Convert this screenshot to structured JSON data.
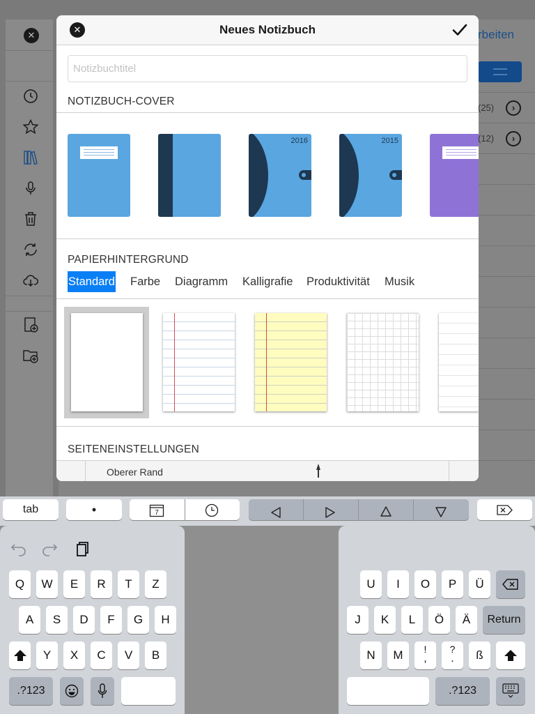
{
  "background": {
    "edit_label": "rbeiten",
    "rows": [
      {
        "count": "(25)"
      },
      {
        "count": "(12)"
      }
    ]
  },
  "modal": {
    "title": "Neues Notizbuch",
    "title_input": {
      "value": "",
      "placeholder": "Notizbuchtitel"
    },
    "cover_section_title": "NOTIZBUCH-COVER",
    "covers": [
      {
        "style": "labeled",
        "color": "#5aa6e0",
        "year": ""
      },
      {
        "style": "spine",
        "color": "#5aa6e0",
        "year": ""
      },
      {
        "style": "planner",
        "color": "#5aa6e0",
        "year": "2016"
      },
      {
        "style": "planner",
        "color": "#5aa6e0",
        "year": "2015"
      },
      {
        "style": "labeled",
        "color": "#8f72d6",
        "year": ""
      }
    ],
    "paper_section_title": "PAPIERHINTERGRUND",
    "paper_tabs": [
      "Standard",
      "Farbe",
      "Diagramm",
      "Kalligrafie",
      "Produktivität",
      "Musik"
    ],
    "active_paper_tab": "Standard",
    "papers": [
      "blank",
      "ruled",
      "yellow-ruled",
      "grid",
      "faint-ruled"
    ],
    "selected_paper": "blank",
    "page_settings_title": "SEITENEINSTELLUNGEN",
    "top_margin_label": "Oberer Rand"
  },
  "keyboard": {
    "toolbar": {
      "tab_label": "tab",
      "bullet_label": "•",
      "calendar_day": "7"
    },
    "left_rows": [
      [
        "Q",
        "W",
        "E",
        "R",
        "T",
        "Z"
      ],
      [
        "A",
        "S",
        "D",
        "F",
        "G",
        "H"
      ],
      [
        "Y",
        "X",
        "C",
        "V",
        "B"
      ]
    ],
    "right_rows": [
      [
        "U",
        "I",
        "O",
        "P",
        "Ü"
      ],
      [
        "J",
        "K",
        "L",
        "Ö",
        "Ä"
      ],
      [
        "N",
        "M",
        "ß"
      ]
    ],
    "punct_exclaim": {
      "top": "!",
      "bottom": ","
    },
    "punct_question": {
      "top": "?",
      "bottom": "."
    },
    "numbers_label": ".?123",
    "return_label": "Return"
  },
  "colors": {
    "accent": "#0a7ff5",
    "cover_dark": "#1e3852",
    "margin_red": "#d64a4a"
  }
}
